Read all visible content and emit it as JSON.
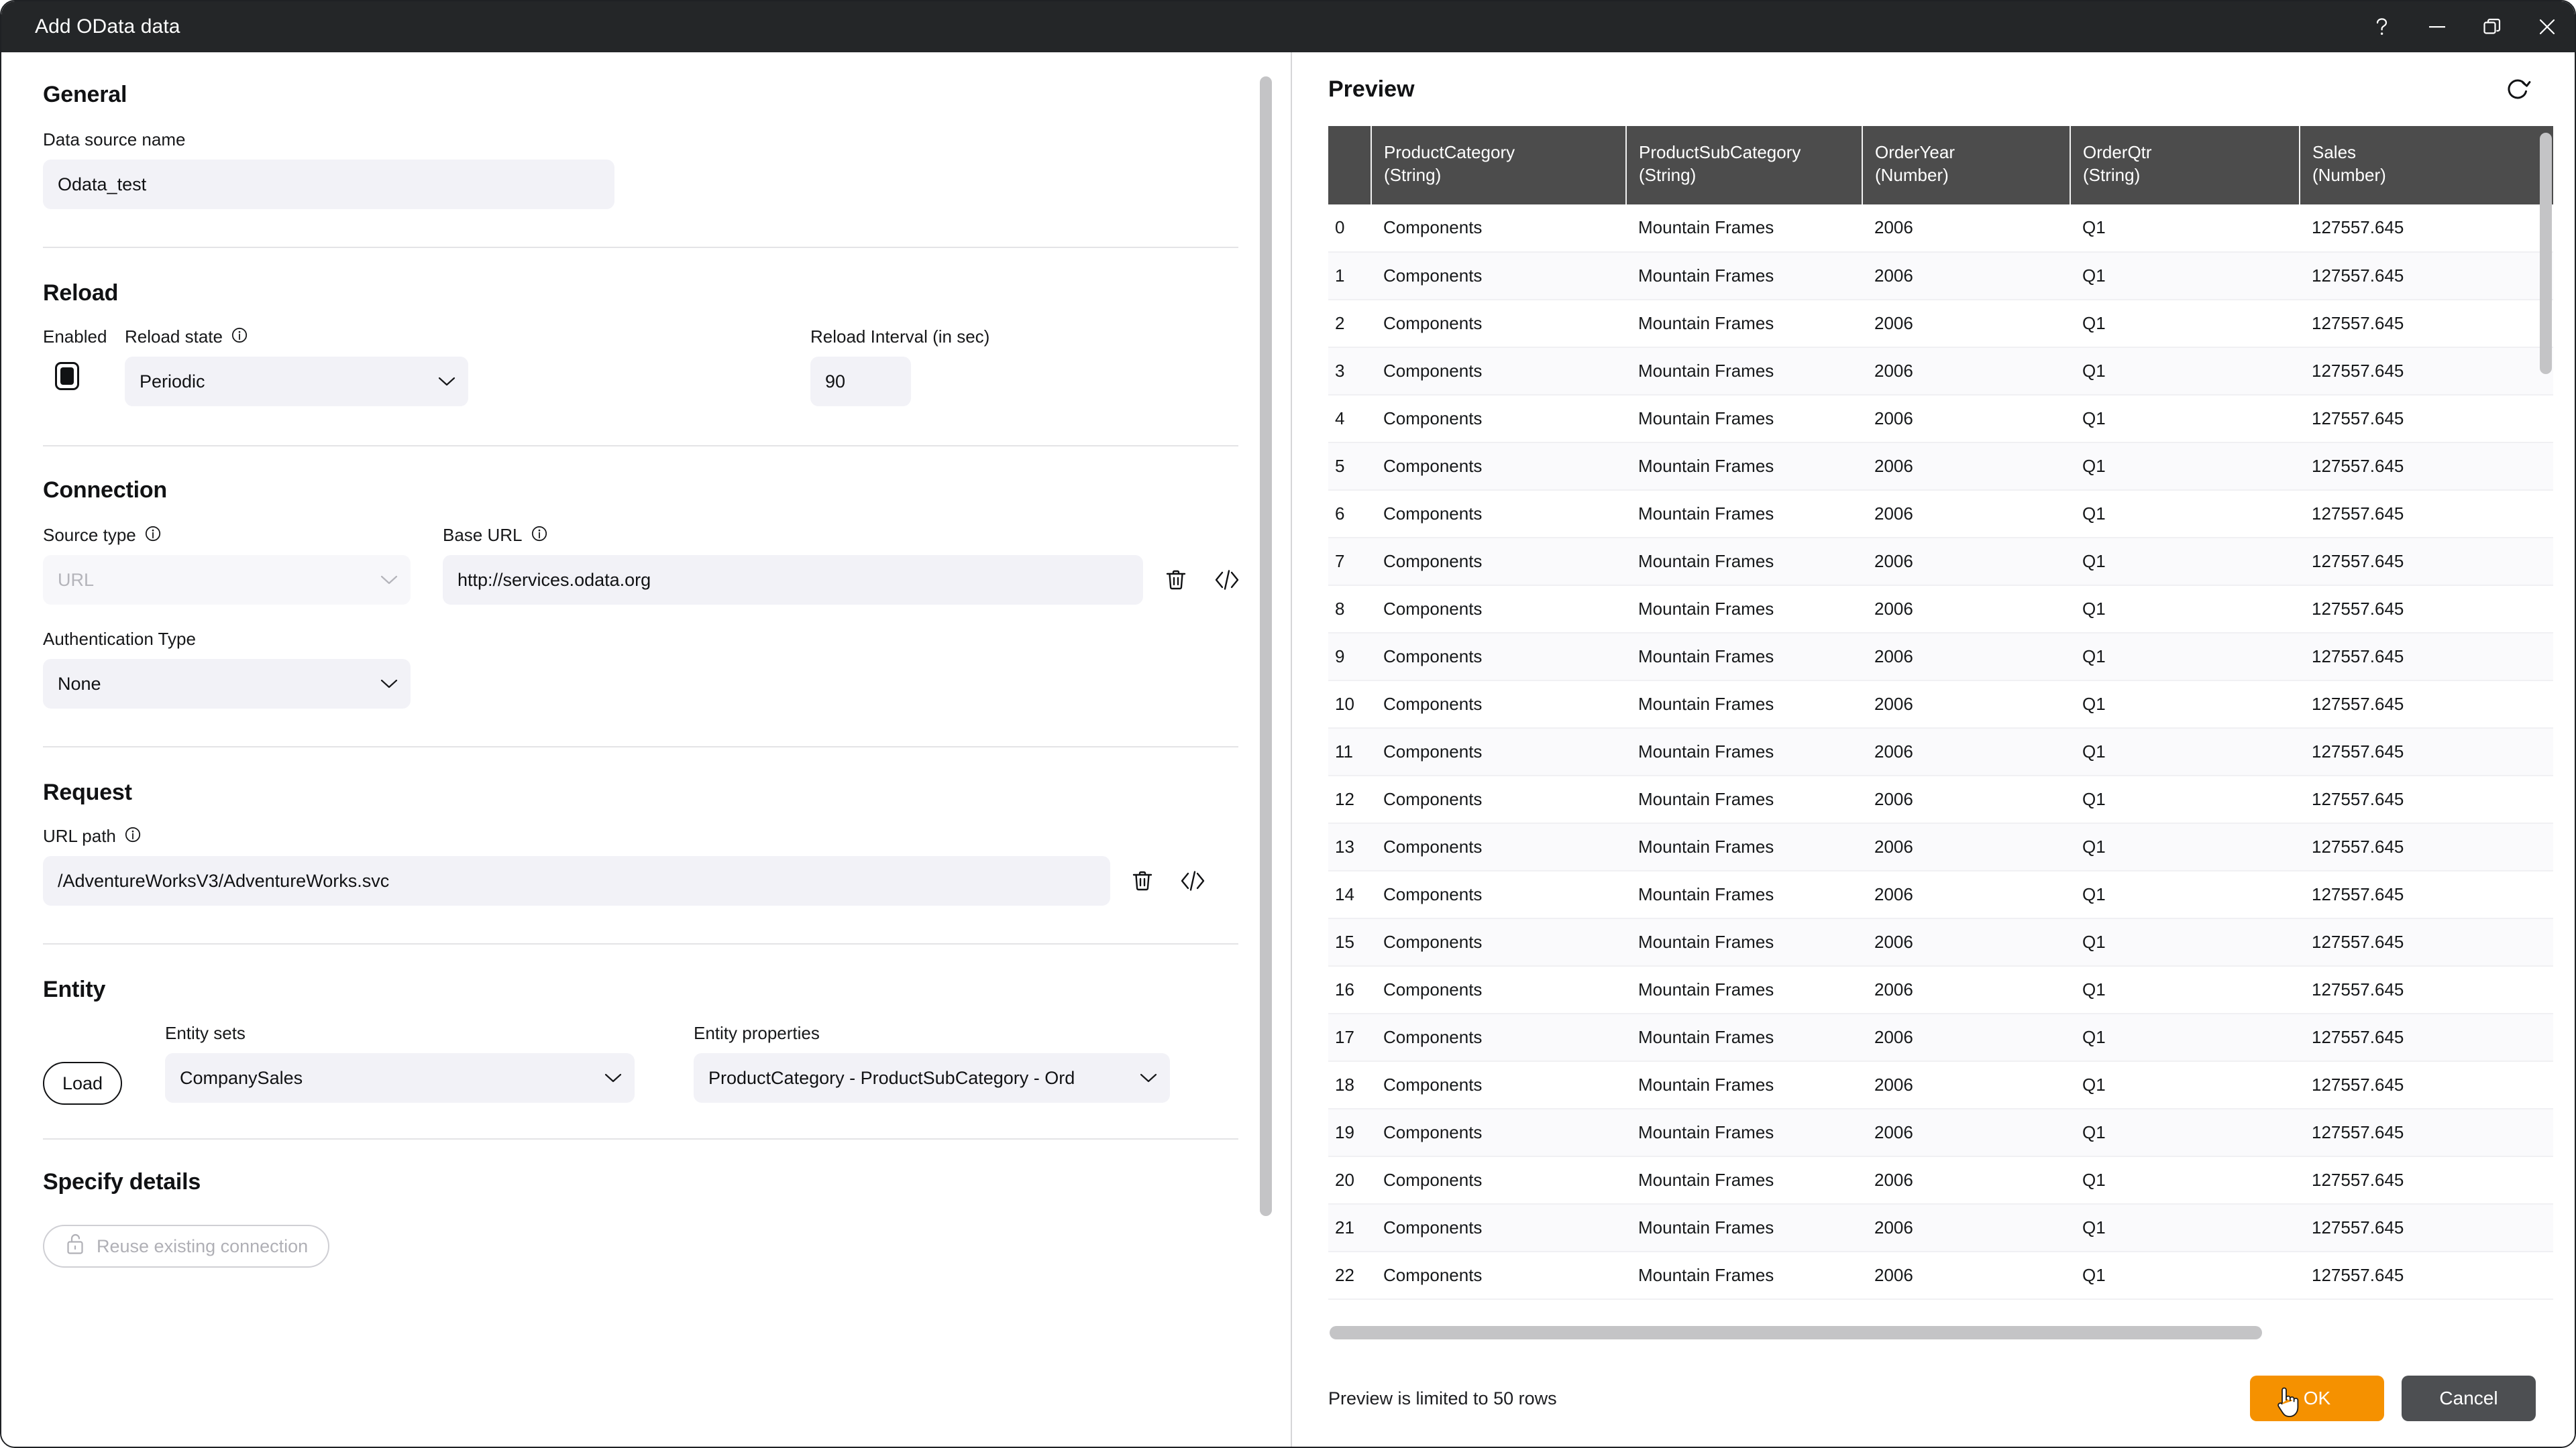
{
  "window": {
    "title": "Add OData data",
    "controls": [
      {
        "name": "help",
        "glyph": "?"
      },
      {
        "name": "minimize",
        "glyph": "—"
      },
      {
        "name": "restore",
        "glyph": "❐"
      },
      {
        "name": "close",
        "glyph": "✕"
      }
    ]
  },
  "form": {
    "general": {
      "heading": "General",
      "data_source_name_label": "Data source name",
      "data_source_name_value": "Odata_test",
      "data_source_name_placeholder": "Data source name"
    },
    "reload": {
      "heading": "Reload",
      "enabled_label": "Enabled",
      "enabled_checked": true,
      "reload_state_label": "Reload state",
      "reload_state_value": "Periodic",
      "reload_interval_label": "Reload Interval (in sec)",
      "reload_interval_value": "90"
    },
    "connection": {
      "heading": "Connection",
      "source_type_label": "Source type",
      "source_type_value": "URL",
      "base_url_label": "Base URL",
      "base_url_value": "http://services.odata.org",
      "auth_type_label": "Authentication Type",
      "auth_type_value": "None"
    },
    "request": {
      "heading": "Request",
      "url_path_label": "URL path",
      "url_path_value": "/AdventureWorksV3/AdventureWorks.svc"
    },
    "entity": {
      "heading": "Entity",
      "load_button": "Load",
      "entity_sets_label": "Entity sets",
      "entity_sets_value": "CompanySales",
      "entity_properties_label": "Entity properties",
      "entity_properties_value": "ProductCategory - ProductSubCategory - Ord"
    },
    "specify_details": {
      "heading": "Specify details",
      "reuse_button": "Reuse existing connection"
    }
  },
  "preview": {
    "title": "Preview",
    "refresh_icon": "refresh-icon",
    "footer_note": "Preview is limited to 50 rows",
    "ok_label": "OK",
    "cancel_label": "Cancel",
    "accent_color": "#f59100",
    "header_color": "#4c4c4c"
  },
  "table_data": {
    "type": "table",
    "index_header": "",
    "columns": [
      {
        "name": "ProductCategory",
        "type": "(String)"
      },
      {
        "name": "ProductSubCategory",
        "type": "(String)"
      },
      {
        "name": "OrderYear",
        "type": "(Number)"
      },
      {
        "name": "OrderQtr",
        "type": "(String)"
      },
      {
        "name": "Sales",
        "type": "(Number)"
      }
    ],
    "rows": [
      {
        "i": "0",
        "c": [
          "Components",
          "Mountain Frames",
          "2006",
          "Q1",
          "127557.645"
        ]
      },
      {
        "i": "1",
        "c": [
          "Components",
          "Mountain Frames",
          "2006",
          "Q1",
          "127557.645"
        ]
      },
      {
        "i": "2",
        "c": [
          "Components",
          "Mountain Frames",
          "2006",
          "Q1",
          "127557.645"
        ]
      },
      {
        "i": "3",
        "c": [
          "Components",
          "Mountain Frames",
          "2006",
          "Q1",
          "127557.645"
        ]
      },
      {
        "i": "4",
        "c": [
          "Components",
          "Mountain Frames",
          "2006",
          "Q1",
          "127557.645"
        ]
      },
      {
        "i": "5",
        "c": [
          "Components",
          "Mountain Frames",
          "2006",
          "Q1",
          "127557.645"
        ]
      },
      {
        "i": "6",
        "c": [
          "Components",
          "Mountain Frames",
          "2006",
          "Q1",
          "127557.645"
        ]
      },
      {
        "i": "7",
        "c": [
          "Components",
          "Mountain Frames",
          "2006",
          "Q1",
          "127557.645"
        ]
      },
      {
        "i": "8",
        "c": [
          "Components",
          "Mountain Frames",
          "2006",
          "Q1",
          "127557.645"
        ]
      },
      {
        "i": "9",
        "c": [
          "Components",
          "Mountain Frames",
          "2006",
          "Q1",
          "127557.645"
        ]
      },
      {
        "i": "10",
        "c": [
          "Components",
          "Mountain Frames",
          "2006",
          "Q1",
          "127557.645"
        ]
      },
      {
        "i": "11",
        "c": [
          "Components",
          "Mountain Frames",
          "2006",
          "Q1",
          "127557.645"
        ]
      },
      {
        "i": "12",
        "c": [
          "Components",
          "Mountain Frames",
          "2006",
          "Q1",
          "127557.645"
        ]
      },
      {
        "i": "13",
        "c": [
          "Components",
          "Mountain Frames",
          "2006",
          "Q1",
          "127557.645"
        ]
      },
      {
        "i": "14",
        "c": [
          "Components",
          "Mountain Frames",
          "2006",
          "Q1",
          "127557.645"
        ]
      },
      {
        "i": "15",
        "c": [
          "Components",
          "Mountain Frames",
          "2006",
          "Q1",
          "127557.645"
        ]
      },
      {
        "i": "16",
        "c": [
          "Components",
          "Mountain Frames",
          "2006",
          "Q1",
          "127557.645"
        ]
      },
      {
        "i": "17",
        "c": [
          "Components",
          "Mountain Frames",
          "2006",
          "Q1",
          "127557.645"
        ]
      },
      {
        "i": "18",
        "c": [
          "Components",
          "Mountain Frames",
          "2006",
          "Q1",
          "127557.645"
        ]
      },
      {
        "i": "19",
        "c": [
          "Components",
          "Mountain Frames",
          "2006",
          "Q1",
          "127557.645"
        ]
      },
      {
        "i": "20",
        "c": [
          "Components",
          "Mountain Frames",
          "2006",
          "Q1",
          "127557.645"
        ]
      },
      {
        "i": "21",
        "c": [
          "Components",
          "Mountain Frames",
          "2006",
          "Q1",
          "127557.645"
        ]
      },
      {
        "i": "22",
        "c": [
          "Components",
          "Mountain Frames",
          "2006",
          "Q1",
          "127557.645"
        ]
      }
    ]
  }
}
